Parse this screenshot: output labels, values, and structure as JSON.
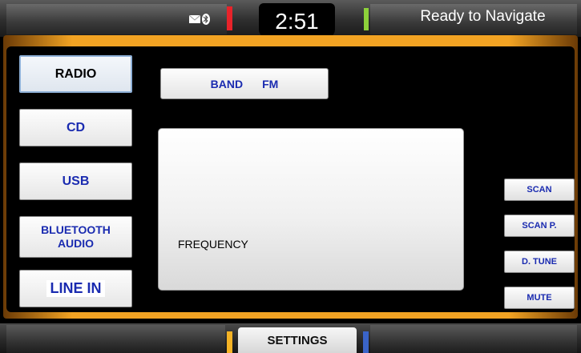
{
  "status_bar": {
    "time": "2:51",
    "navigation_status": "Ready to Navigate",
    "icons": [
      "mail-icon",
      "bluetooth-icon"
    ]
  },
  "sources": [
    {
      "label": "RADIO",
      "active": true
    },
    {
      "label": "CD",
      "active": false
    },
    {
      "label": "USB",
      "active": false
    },
    {
      "label": "BLUETOOTH AUDIO",
      "line1": "BLUETOOTH",
      "line2": "AUDIO",
      "active": false
    },
    {
      "label": "LINE IN",
      "active": false
    }
  ],
  "band": {
    "label": "BAND",
    "value": "FM"
  },
  "frequency_panel": {
    "label": "FREQUENCY"
  },
  "side_controls": [
    "SCAN",
    "SCAN P.",
    "D. TUNE",
    "MUTE"
  ],
  "bottom_bar": {
    "settings_label": "SETTINGS"
  },
  "colors": {
    "accent_orange": "#f2a323",
    "button_text_blue": "#1a2bb0",
    "indicator_red": "#e8232a",
    "indicator_green": "#8dd13a",
    "indicator_yellow": "#f5b325",
    "indicator_blue": "#3a64c8"
  }
}
